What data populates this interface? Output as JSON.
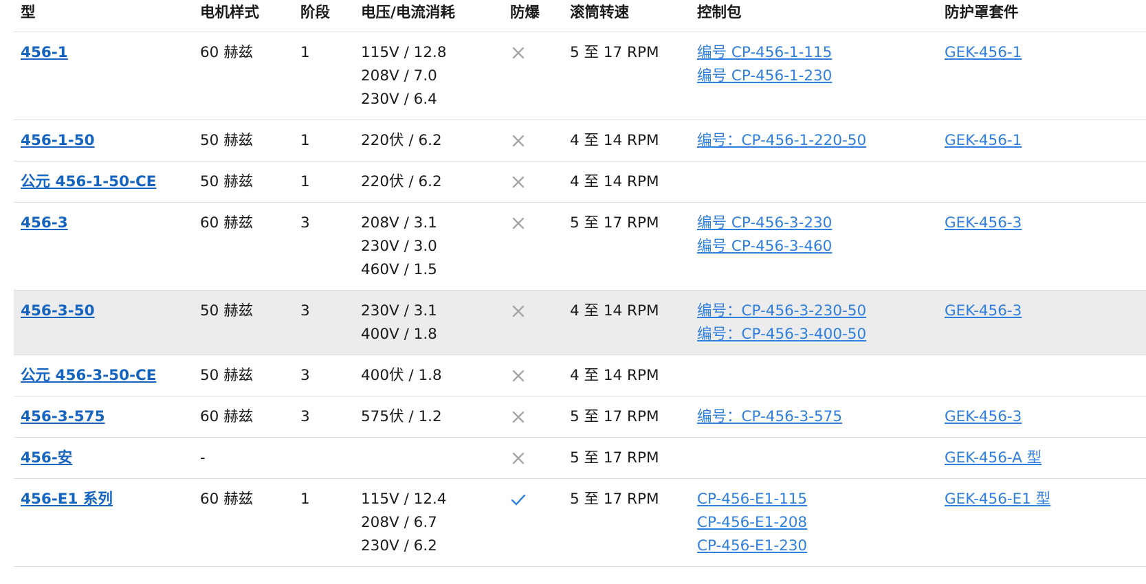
{
  "headers": [
    "型",
    "电机样式",
    "阶段",
    "电压/电流消耗",
    "防爆",
    "滚筒转速",
    "控制包",
    "防护罩套件"
  ],
  "icons": {
    "no": "x-mark-icon",
    "yes": "check-mark-icon",
    "no_color": "#a6a6a6",
    "yes_color": "#2f7fe0"
  },
  "colors": {
    "model_link": "#1565c0",
    "link": "#2f7fe0",
    "highlight_row": "#ececec"
  },
  "rows": [
    {
      "model": "456-1",
      "motor": "60 赫兹",
      "phase": "1",
      "voltage": [
        "115V / 12.8",
        "208V / 7.0",
        "230V / 6.4"
      ],
      "explosion_proof": "no",
      "speed": "5 至 17 RPM",
      "control": [
        "编号 CP-456-1-115",
        "编号 CP-456-1-230"
      ],
      "shield": "GEK-456-1"
    },
    {
      "model": "456-1-50",
      "motor": "50 赫兹",
      "phase": "1",
      "voltage": [
        "220伏 / 6.2"
      ],
      "explosion_proof": "no",
      "speed": "4 至 14 RPM",
      "control": [
        "编号：CP-456-1-220-50"
      ],
      "shield": "GEK-456-1"
    },
    {
      "model": "公元 456-1-50-CE",
      "motor": "50 赫兹",
      "phase": "1",
      "voltage": [
        "220伏 / 6.2"
      ],
      "explosion_proof": "no",
      "speed": "4 至 14 RPM",
      "control": [],
      "shield": ""
    },
    {
      "model": "456-3",
      "motor": "60 赫兹",
      "phase": "3",
      "voltage": [
        "208V / 3.1",
        "230V / 3.0",
        "460V / 1.5"
      ],
      "explosion_proof": "no",
      "speed": "5 至 17 RPM",
      "control": [
        "编号 CP-456-3-230",
        "编号 CP-456-3-460"
      ],
      "shield": "GEK-456-3"
    },
    {
      "model": "456-3-50",
      "motor": "50 赫兹",
      "phase": "3",
      "voltage": [
        "230V / 3.1",
        "400V / 1.8"
      ],
      "explosion_proof": "no",
      "speed": "4 至 14 RPM",
      "control": [
        "编号：CP-456-3-230-50",
        "编号：CP-456-3-400-50"
      ],
      "shield": "GEK-456-3",
      "highlighted": true
    },
    {
      "model": "公元 456-3-50-CE",
      "motor": "50 赫兹",
      "phase": "3",
      "voltage": [
        "400伏 / 1.8"
      ],
      "explosion_proof": "no",
      "speed": "4 至 14 RPM",
      "control": [],
      "shield": ""
    },
    {
      "model": "456-3-575",
      "motor": "60 赫兹",
      "phase": "3",
      "voltage": [
        "575伏 / 1.2"
      ],
      "explosion_proof": "no",
      "speed": "5 至 17 RPM",
      "control": [
        "编号：CP-456-3-575"
      ],
      "shield": "GEK-456-3"
    },
    {
      "model": "456-安",
      "motor": "-",
      "phase": "",
      "voltage": [],
      "explosion_proof": "no",
      "speed": "5 至 17 RPM",
      "control": [],
      "shield": "GEK-456-A 型"
    },
    {
      "model": "456-E1 系列",
      "motor": "60 赫兹",
      "phase": "1",
      "voltage": [
        "115V / 12.4",
        "208V / 6.7",
        "230V / 6.2"
      ],
      "explosion_proof": "yes",
      "speed": "5 至 17 RPM",
      "control": [
        "CP-456-E1-115",
        "CP-456-E1-208",
        "CP-456-E1-230"
      ],
      "shield": "GEK-456-E1 型"
    }
  ]
}
